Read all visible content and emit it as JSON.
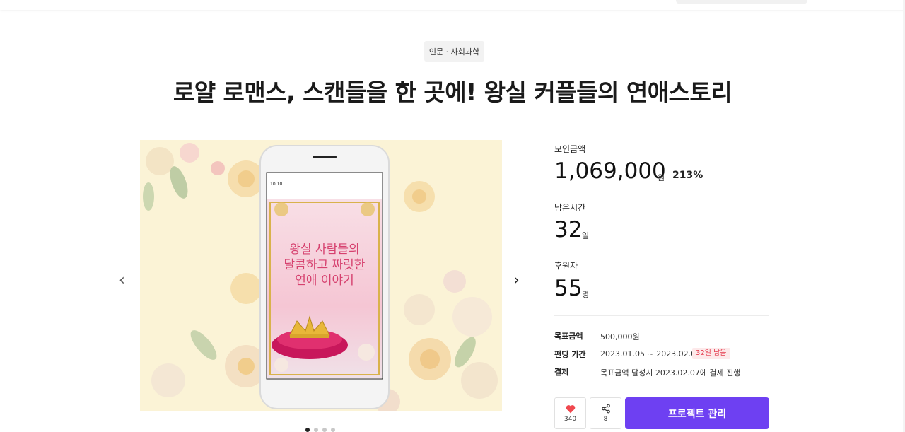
{
  "category": "인문 · 사회과학",
  "title": "로얄 로맨스, 스캔들을 한 곳에! 왕실 커플들의 연애스토리",
  "gallery": {
    "cover_title_line1": "왕실 사람들의",
    "cover_title_line2": "달콤하고 짜릿한",
    "cover_title_line3": "연애 이야기",
    "phone_status_time": "10:10",
    "slide_count": 4,
    "active_slide": 1
  },
  "stats": {
    "amount_label": "모인금액",
    "amount_value": "1,069,000",
    "amount_unit": "원",
    "amount_percent": "213%",
    "time_label": "남은시간",
    "time_value": "32",
    "time_unit": "일",
    "backers_label": "후원자",
    "backers_value": "55",
    "backers_unit": "명"
  },
  "info": {
    "goal_label": "목표금액",
    "goal_value": "500,000원",
    "period_label": "펀딩 기간",
    "period_value": "2023.01.05 ~ 2023.02.06",
    "period_badge": "32일 남음",
    "payment_label": "결제",
    "payment_value": "목표금액 달성시 2023.02.07에 결제 진행"
  },
  "actions": {
    "like_count": "340",
    "share_count": "8",
    "manage_label": "프로젝트 관리"
  },
  "colors": {
    "accent": "#6e40f2",
    "heart": "#f0484f",
    "badge_text": "#e4394c",
    "badge_bg": "#fde9ea"
  }
}
